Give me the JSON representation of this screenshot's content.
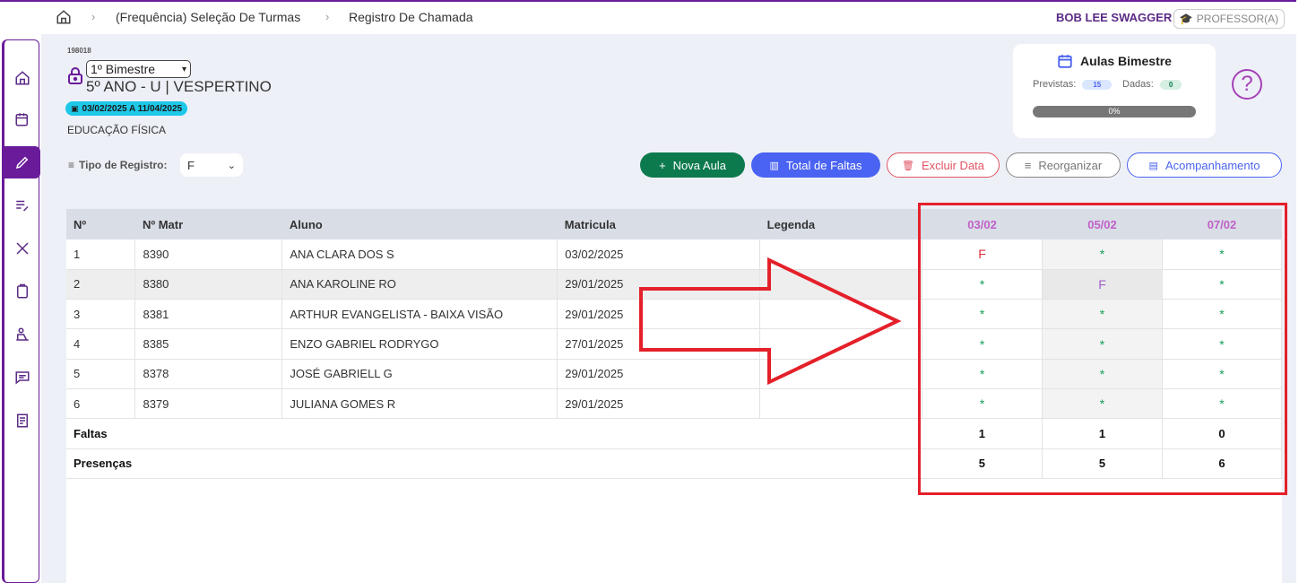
{
  "breadcrumb": {
    "items": [
      "(Frequência) Seleção De Turmas",
      "Registro De Chamada"
    ]
  },
  "user": {
    "name": "BOB LEE SWAGGER",
    "role": "PROFESSOR(A)"
  },
  "header": {
    "code": "198018",
    "bimestre": "1º Bimestre",
    "turma": "5º ANO - U | VESPERTINO",
    "periodo": "03/02/2025 A 11/04/2025",
    "disciplina": "EDUCAÇÃO FÍSICA"
  },
  "tipo_registro": {
    "label": "Tipo de Registro:",
    "value": "F"
  },
  "aulas_card": {
    "title": "Aulas Bimestre",
    "previstas_label": "Previstas:",
    "previstas": "15",
    "dadas_label": "Dadas:",
    "dadas": "0",
    "progress": "0%"
  },
  "buttons": {
    "nova": "Nova Aula",
    "total": "Total de Faltas",
    "excluir": "Excluir Data",
    "reorganizar": "Reorganizar",
    "acompanhamento": "Acompanhamento"
  },
  "table": {
    "headers": {
      "n": "Nº",
      "matr": "Nº Matr",
      "aluno": "Aluno",
      "matricula": "Matricula",
      "legenda": "Legenda",
      "d1": "03/02",
      "d2": "05/02",
      "d3": "07/02"
    },
    "rows": [
      {
        "n": "1",
        "matr": "8390",
        "aluno": "ANA CLARA DOS S",
        "matricula": "03/02/2025",
        "d1": "F",
        "d2": "*",
        "d3": "*"
      },
      {
        "n": "2",
        "matr": "8380",
        "aluno": "ANA KAROLINE RO",
        "matricula": "29/01/2025",
        "d1": "*",
        "d2": "F",
        "d3": "*"
      },
      {
        "n": "3",
        "matr": "8381",
        "aluno": "ARTHUR EVANGELISTA - BAIXA VISÃO",
        "matricula": "29/01/2025",
        "d1": "*",
        "d2": "*",
        "d3": "*"
      },
      {
        "n": "4",
        "matr": "8385",
        "aluno": "ENZO GABRIEL RODRYGO",
        "matricula": "27/01/2025",
        "d1": "*",
        "d2": "*",
        "d3": "*"
      },
      {
        "n": "5",
        "matr": "8378",
        "aluno": "JOSÉ GABRIELL G",
        "matricula": "29/01/2025",
        "d1": "*",
        "d2": "*",
        "d3": "*"
      },
      {
        "n": "6",
        "matr": "8379",
        "aluno": "JULIANA GOMES R",
        "matricula": "29/01/2025",
        "d1": "*",
        "d2": "*",
        "d3": "*"
      }
    ],
    "faltas": {
      "label": "Faltas",
      "d1": "1",
      "d2": "1",
      "d3": "0"
    },
    "presencas": {
      "label": "Presenças",
      "d1": "5",
      "d2": "5",
      "d3": "6"
    }
  },
  "colors": {
    "brand": "#6a1b9a",
    "nova": "#0d7a4e",
    "total": "#4a63f2",
    "danger": "#e25363",
    "highlight": "#e4202a"
  }
}
